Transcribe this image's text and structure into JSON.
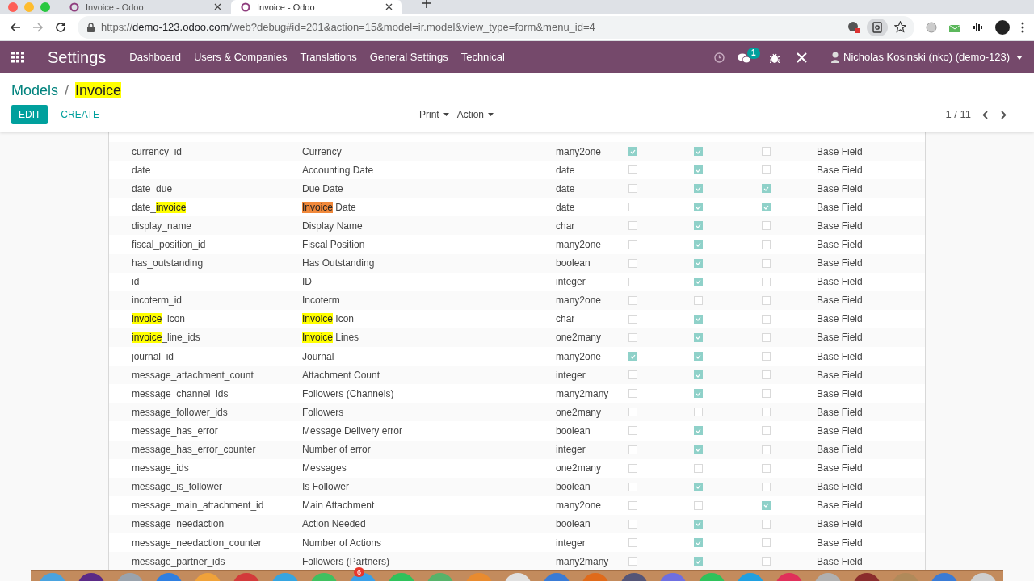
{
  "browser": {
    "tabs": [
      {
        "title": "Invoice - Odoo",
        "selected": false
      },
      {
        "title": "Invoice - Odoo",
        "selected": true
      }
    ],
    "url": {
      "host": "demo-123.odoo.com",
      "path": "/web?debug#id=201&action=15&model=ir.model&view_type=form&menu_id=4",
      "protocol": "https://"
    }
  },
  "navbar": {
    "app": "Settings",
    "menu": [
      "Dashboard",
      "Users & Companies",
      "Translations",
      "General Settings",
      "Technical"
    ],
    "messages_badge": "1",
    "user": "Nicholas Kosinski (nko) (demo-123)"
  },
  "breadcrumb": {
    "parent": "Models",
    "separator": "/",
    "current": [
      {
        "text": "Invoice",
        "highlighted": true
      }
    ]
  },
  "buttons": [
    {
      "label": "EDIT",
      "kind": "primary"
    },
    {
      "label": "CREATE",
      "kind": "link"
    }
  ],
  "dropdowns": [
    "Print",
    "Action"
  ],
  "pager": "1 / 11",
  "fields": [
    {
      "name": "currency_id",
      "label": "Currency",
      "type": "many2one",
      "checks": [
        true,
        true,
        false
      ],
      "column_7": "Base Field"
    },
    {
      "name": "date",
      "label": "Accounting Date",
      "type": "date",
      "checks": [
        false,
        true,
        false
      ],
      "column_7": "Base Field"
    },
    {
      "name": "date_due",
      "label": "Due Date",
      "type": "date",
      "checks": [
        false,
        true,
        true
      ],
      "column_7": "Base Field"
    },
    {
      "name": [
        {
          "text": "date_"
        },
        {
          "text": "invoice",
          "highlighted": true
        }
      ],
      "label": [
        {
          "text": "Invoice",
          "highlighted": true,
          "current": true
        },
        {
          "text": " Date"
        }
      ],
      "type": "date",
      "checks": [
        false,
        true,
        true
      ],
      "column_7": "Base Field"
    },
    {
      "name": "display_name",
      "label": "Display Name",
      "type": "char",
      "checks": [
        false,
        true,
        false
      ],
      "column_7": "Base Field"
    },
    {
      "name": "fiscal_position_id",
      "label": "Fiscal Position",
      "type": "many2one",
      "checks": [
        false,
        true,
        false
      ],
      "column_7": "Base Field"
    },
    {
      "name": "has_outstanding",
      "label": "Has Outstanding",
      "type": "boolean",
      "checks": [
        false,
        true,
        false
      ],
      "column_7": "Base Field"
    },
    {
      "name": "id",
      "label": "ID",
      "type": "integer",
      "checks": [
        false,
        true,
        false
      ],
      "column_7": "Base Field"
    },
    {
      "name": "incoterm_id",
      "label": "Incoterm",
      "type": "many2one",
      "checks": [
        false,
        false,
        false
      ],
      "column_7": "Base Field"
    },
    {
      "name": [
        {
          "text": "invoice",
          "highlighted": true
        },
        {
          "text": "_icon"
        }
      ],
      "label": [
        {
          "text": "Invoice",
          "highlighted": true
        },
        {
          "text": " Icon"
        }
      ],
      "type": "char",
      "checks": [
        false,
        true,
        false
      ],
      "column_7": "Base Field"
    },
    {
      "name": [
        {
          "text": "invoice",
          "highlighted": true
        },
        {
          "text": "_line_ids"
        }
      ],
      "label": [
        {
          "text": "Invoice",
          "highlighted": true
        },
        {
          "text": " Lines"
        }
      ],
      "type": "one2many",
      "checks": [
        false,
        true,
        false
      ],
      "column_7": "Base Field"
    },
    {
      "name": "journal_id",
      "label": "Journal",
      "type": "many2one",
      "checks": [
        true,
        true,
        false
      ],
      "column_7": "Base Field"
    },
    {
      "name": "message_attachment_count",
      "label": "Attachment Count",
      "type": "integer",
      "checks": [
        false,
        true,
        false
      ],
      "column_7": "Base Field"
    },
    {
      "name": "message_channel_ids",
      "label": "Followers (Channels)",
      "type": "many2many",
      "checks": [
        false,
        true,
        false
      ],
      "column_7": "Base Field"
    },
    {
      "name": "message_follower_ids",
      "label": "Followers",
      "type": "one2many",
      "checks": [
        false,
        false,
        false
      ],
      "column_7": "Base Field"
    },
    {
      "name": "message_has_error",
      "label": "Message Delivery error",
      "type": "boolean",
      "checks": [
        false,
        true,
        false
      ],
      "column_7": "Base Field"
    },
    {
      "name": "message_has_error_counter",
      "label": "Number of error",
      "type": "integer",
      "checks": [
        false,
        true,
        false
      ],
      "column_7": "Base Field"
    },
    {
      "name": "message_ids",
      "label": "Messages",
      "type": "one2many",
      "checks": [
        false,
        false,
        false
      ],
      "column_7": "Base Field"
    },
    {
      "name": "message_is_follower",
      "label": "Is Follower",
      "type": "boolean",
      "checks": [
        false,
        true,
        false
      ],
      "column_7": "Base Field"
    },
    {
      "name": "message_main_attachment_id",
      "label": "Main Attachment",
      "type": "many2one",
      "checks": [
        false,
        false,
        true
      ],
      "column_7": "Base Field"
    },
    {
      "name": "message_needaction",
      "label": "Action Needed",
      "type": "boolean",
      "checks": [
        false,
        true,
        false
      ],
      "column_7": "Base Field"
    },
    {
      "name": "message_needaction_counter",
      "label": "Number of Actions",
      "type": "integer",
      "checks": [
        false,
        true,
        false
      ],
      "column_7": "Base Field"
    },
    {
      "name": "message_partner_ids",
      "label": "Followers (Partners)",
      "type": "many2many",
      "checks": [
        false,
        true,
        false
      ],
      "column_7": "Base Field"
    }
  ],
  "dock": {
    "badge": "6"
  }
}
